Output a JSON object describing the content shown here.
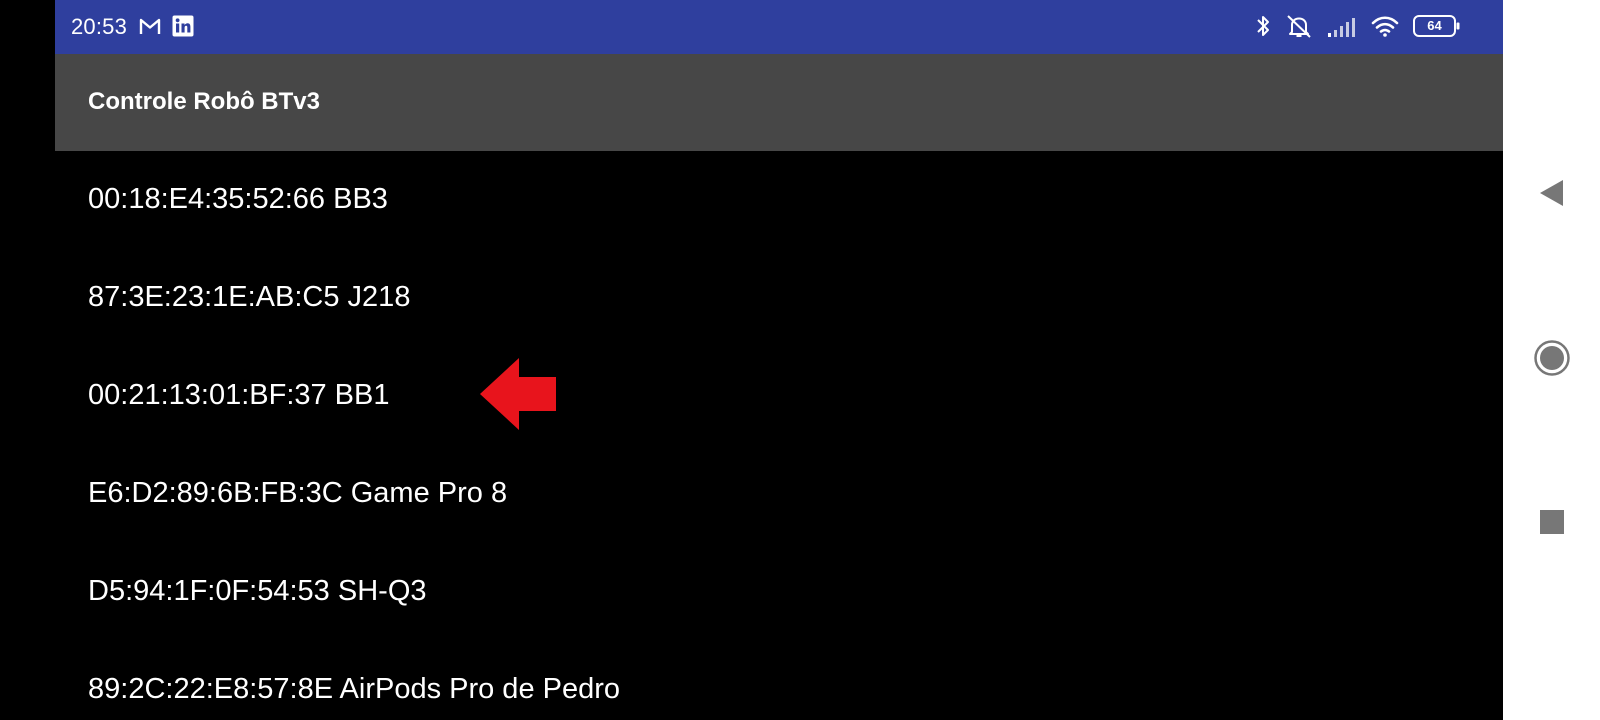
{
  "status_bar": {
    "time": "20:53",
    "battery_level": "64",
    "left_icons": [
      "gmail-icon",
      "linkedin-icon"
    ],
    "right_icons": [
      "bluetooth-icon",
      "alarm-off-icon",
      "signal-icon",
      "wifi-icon",
      "battery-icon"
    ],
    "background_color": "#2f3f9e"
  },
  "app_bar": {
    "title": "Controle Robô BTv3",
    "background_color": "#474747"
  },
  "devices": [
    {
      "label": "00:18:E4:35:52:66 BB3"
    },
    {
      "label": "87:3E:23:1E:AB:C5 J218"
    },
    {
      "label": "00:21:13:01:BF:37 BB1"
    },
    {
      "label": "E6:D2:89:6B:FB:3C Game Pro 8"
    },
    {
      "label": "D5:94:1F:0F:54:53 SH-Q3"
    },
    {
      "label": "89:2C:22:E8:57:8E AirPods Pro de Pedro"
    }
  ],
  "annotation": {
    "icon": "red-arrow-left-icon",
    "color": "#e8141c"
  },
  "nav_bar": {
    "buttons": [
      "back-icon",
      "home-icon",
      "recents-icon"
    ],
    "icon_color": "#777777"
  }
}
